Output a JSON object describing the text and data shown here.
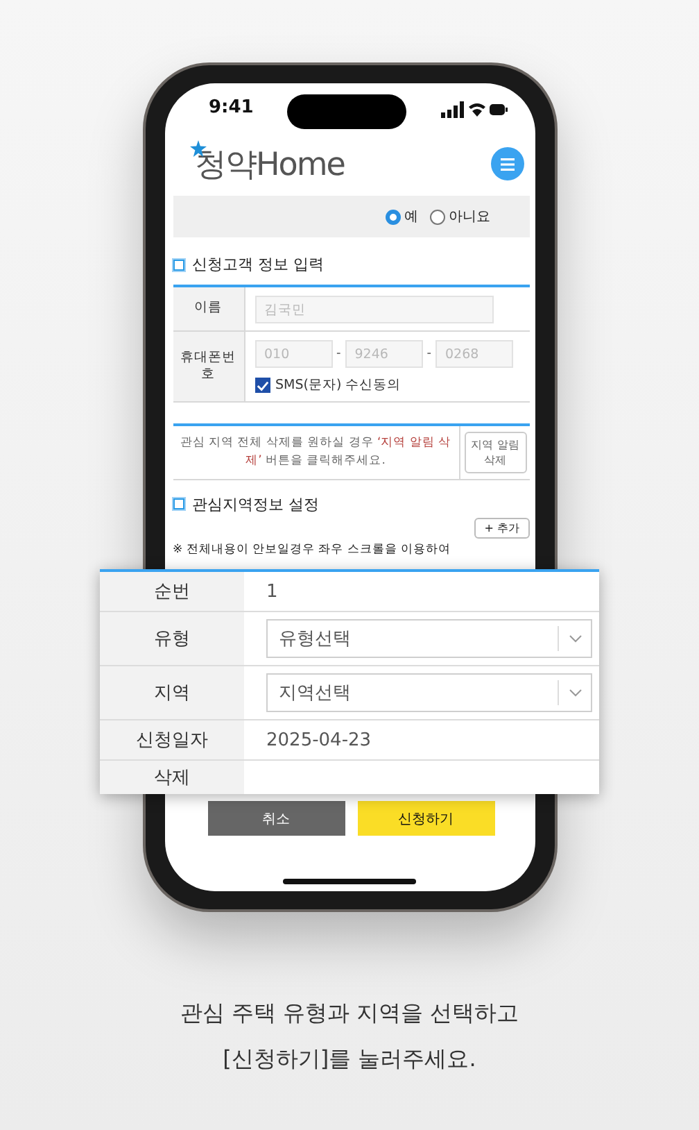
{
  "status_bar": {
    "time": "9:41"
  },
  "header": {
    "logo": "청약Home"
  },
  "consent": {
    "options": [
      {
        "label": "예",
        "selected": true
      },
      {
        "label": "아니요",
        "selected": false
      }
    ]
  },
  "customer_section": {
    "title": "신청고객 정보 입력",
    "rows": [
      {
        "label": "이름",
        "kind": "name",
        "fields": [
          {
            "placeholder": "김국민"
          }
        ]
      },
      {
        "label": "휴대폰번호",
        "kind": "phone",
        "fields": [
          {
            "placeholder": "010"
          },
          {
            "placeholder": "9246"
          },
          {
            "placeholder": "0268"
          }
        ],
        "separator": "-",
        "sms": {
          "label": "SMS(문자) 수신동의",
          "checked": true
        }
      }
    ]
  },
  "notice": {
    "parts": [
      {
        "text": "관심 지역 전체 삭제를 원하실 경우 ",
        "kind": "plain"
      },
      {
        "text": "‘지역 알림 삭제’",
        "kind": "emphasis"
      },
      {
        "text": " 버튼을 클릭해주세요.",
        "kind": "plain"
      }
    ],
    "button": "지역 알림 삭제"
  },
  "region_section": {
    "title": "관심지역정보 설정",
    "add_button": "+ 추가",
    "note": "※ 전체내용이 안보일경우 좌우 스크롤을 이용하여"
  },
  "region_table": {
    "rows": [
      {
        "label": "순번",
        "kind": "text",
        "value": "1"
      },
      {
        "label": "유형",
        "kind": "select",
        "value": "유형선택"
      },
      {
        "label": "지역",
        "kind": "select",
        "value": "지역선택"
      },
      {
        "label": "신청일자",
        "kind": "text",
        "value": "2025-04-23"
      },
      {
        "label": "삭제",
        "kind": "empty"
      }
    ]
  },
  "buttons": [
    {
      "label": "취소",
      "kind": "cancel"
    },
    {
      "label": "신청하기",
      "kind": "primary"
    }
  ],
  "caption": [
    "관심 주택 유형과 지역을 선택하고",
    "[신청하기]를 눌러주세요."
  ]
}
